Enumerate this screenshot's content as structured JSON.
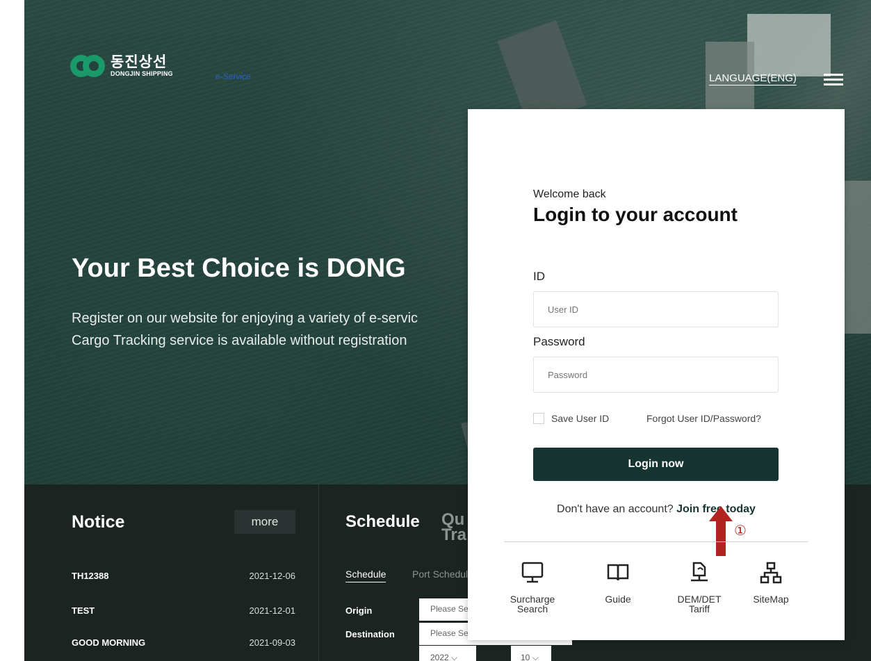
{
  "header": {
    "logo_kr": "동진상선",
    "logo_en": "DONGJIN SHIPPING",
    "eservice": "e-Service",
    "language": "LANGUAGE(ENG)"
  },
  "hero": {
    "title": "Your Best Choice is DONG",
    "subtitle_line1": "Register on our website for enjoying a variety of e-servic",
    "subtitle_line2": "Cargo Tracking service is available without registration"
  },
  "notice": {
    "title": "Notice",
    "more": "more",
    "items": [
      {
        "title": "TH12388",
        "date": "2021-12-06"
      },
      {
        "title": "TEST",
        "date": "2021-12-01"
      },
      {
        "title": "GOOD MORNING",
        "date": "2021-09-03"
      }
    ]
  },
  "schedule": {
    "title": "Schedule",
    "quick_line1": "Qu",
    "quick_line2": "Tra",
    "tabs": [
      "Schedule",
      "Port Schedule"
    ],
    "origin_label": "Origin",
    "destination_label": "Destination",
    "origin_placeholder": "Please Se",
    "destination_placeholder": "Please Se",
    "year": "2022",
    "month": "10"
  },
  "login": {
    "welcome": "Welcome back",
    "title": "Login to your account",
    "id_label": "ID",
    "id_placeholder": "User ID",
    "password_label": "Password",
    "password_placeholder": "Password",
    "save_id": "Save User ID",
    "forgot": "Forgot User ID/Password?",
    "button": "Login now",
    "no_account": "Don't have an account?",
    "join": "Join free today",
    "annotation": "①",
    "quick_links": [
      {
        "label_line1": "Surcharge",
        "label_line2": "Search",
        "icon": "monitor-icon"
      },
      {
        "label_line1": "Guide",
        "label_line2": "",
        "icon": "book-icon"
      },
      {
        "label_line1": "DEM/DET",
        "label_line2": "Tariff",
        "icon": "network-file-icon"
      },
      {
        "label_line1": "SiteMap",
        "label_line2": "",
        "icon": "sitemap-icon"
      }
    ]
  },
  "colors": {
    "accent": "#163530",
    "logo_green": "#1a9a6a",
    "annotation_red": "#b3231f"
  }
}
